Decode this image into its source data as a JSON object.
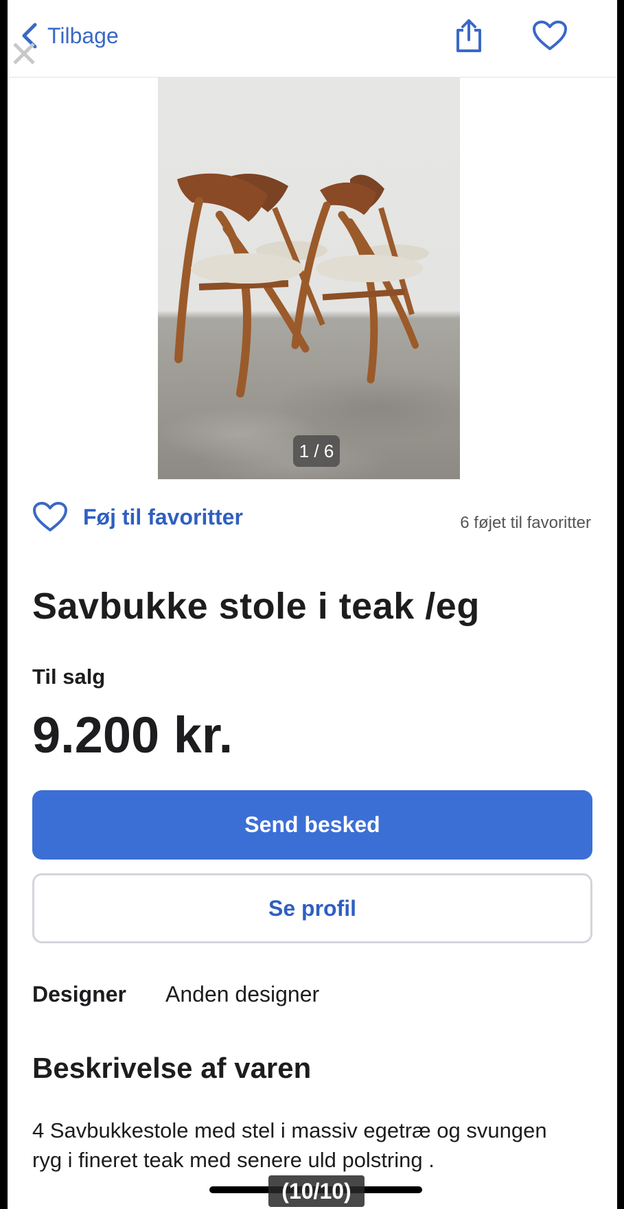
{
  "nav": {
    "back_label": "Tilbage"
  },
  "gallery": {
    "counter": "1 / 6",
    "image_subject": "four-chairs-photo"
  },
  "favorites": {
    "add_label": "Føj til favoritter",
    "count_text": "6 føjet til favoritter"
  },
  "listing": {
    "title": "Savbukke stole i teak /eg",
    "status": "Til salg",
    "price": "9.200 kr."
  },
  "actions": {
    "message_label": "Send besked",
    "profile_label": "Se profil"
  },
  "details": {
    "designer_key": "Designer",
    "designer_value": "Anden designer"
  },
  "description": {
    "heading": "Beskrivelse af varen",
    "text": "4 Savbukkestole med stel i massiv egetræ og svungen ryg i fineret teak med senere uld polstring ."
  },
  "overlay": {
    "caption": "(10/10)"
  },
  "colors": {
    "accent": "#3c6fd6",
    "link": "#2f5fc1",
    "text": "#1d1d1f"
  }
}
